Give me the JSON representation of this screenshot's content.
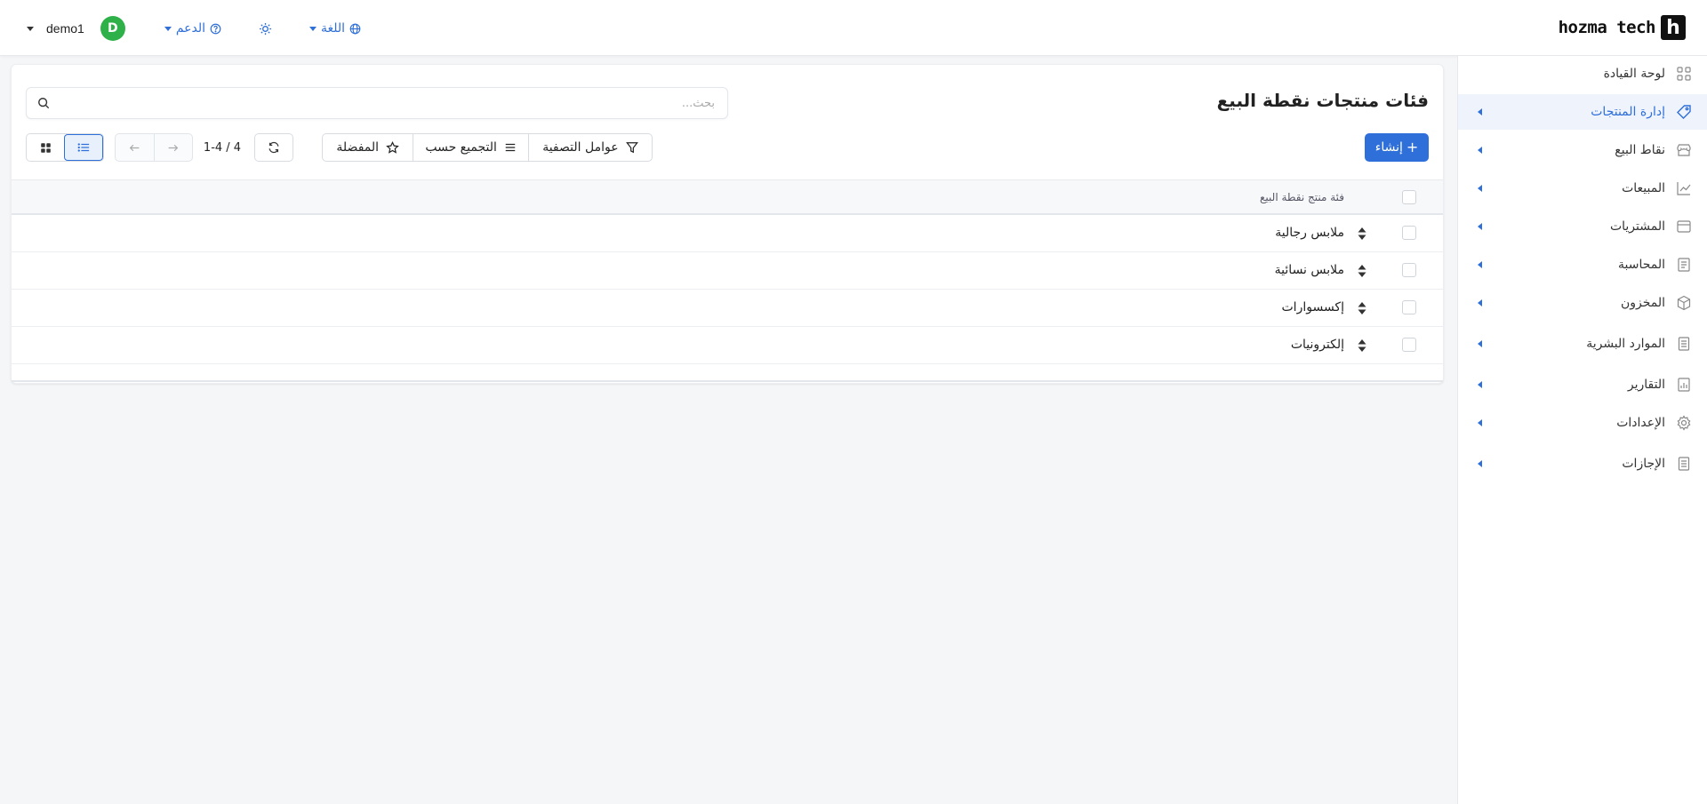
{
  "brand": {
    "mark": "h",
    "name": "hozma tech"
  },
  "topbar": {
    "user_name": "demo1",
    "avatar_initial": "D",
    "support_label": "الدعم",
    "language_label": "اللغة"
  },
  "sidebar": {
    "items": [
      {
        "label": "لوحة القيادة",
        "icon": "dashboard-icon",
        "has_submenu": false
      },
      {
        "label": "إدارة المنتجات",
        "icon": "tag-icon",
        "has_submenu": true,
        "active": true
      },
      {
        "label": "نقاط البيع",
        "icon": "store-icon",
        "has_submenu": true
      },
      {
        "label": "المبيعات",
        "icon": "chart-line-icon",
        "has_submenu": true
      },
      {
        "label": "المشتريات",
        "icon": "wallet-icon",
        "has_submenu": true
      },
      {
        "label": "المحاسبة",
        "icon": "ledger-icon",
        "has_submenu": true
      },
      {
        "label": "المخزون",
        "icon": "box-icon",
        "has_submenu": true
      },
      {
        "label": "الموارد البشرية",
        "icon": "document-icon",
        "has_submenu": true
      },
      {
        "label": "التقارير",
        "icon": "report-icon",
        "has_submenu": true
      },
      {
        "label": "الإعدادات",
        "icon": "gear-icon",
        "has_submenu": true
      },
      {
        "label": "الإجازات",
        "icon": "document-icon",
        "has_submenu": true
      }
    ]
  },
  "main": {
    "title": "فئات منتجات نقطة البيع",
    "search": {
      "placeholder": "بحث...",
      "value": ""
    },
    "toolbar": {
      "create_label": "إنشاء",
      "filters_label": "عوامل التصفية",
      "group_by_label": "التجميع حسب",
      "favorites_label": "المفضلة",
      "pager_text": "1-4 / 4"
    },
    "table": {
      "column_header": "فئة منتج نقطة البيع",
      "rows": [
        {
          "name": "ملابس رجالية"
        },
        {
          "name": "ملابس نسائية"
        },
        {
          "name": "إكسسوارات"
        },
        {
          "name": "إلكترونيات"
        }
      ]
    }
  },
  "colors": {
    "accent": "#2f6fd9",
    "avatar": "#2fb14a",
    "background": "#f5f6f8"
  }
}
